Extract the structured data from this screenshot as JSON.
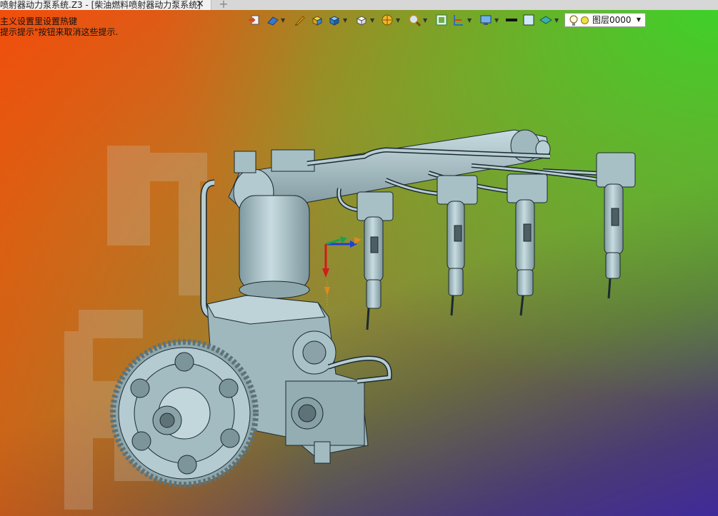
{
  "tab": {
    "title": "喷射器动力泵系统.Z3 - [柴油燃料喷射器动力泵系统]",
    "close_glyph": "✕",
    "new_glyph": "+"
  },
  "viewport": {
    "hint_line1": "主义设置里设置热键",
    "hint_line2": "提示提示\"按钮来取消这些提示."
  },
  "toolbar": {
    "icons": [
      "import-icon",
      "view-dropdown-icon",
      "pencil-icon",
      "cube-yellow-icon",
      "cube-blue-icon",
      "cube-wire-icon",
      "render-mode-icon",
      "zoom-icon",
      "grid-icon",
      "filter-icon",
      "display-icon",
      "line-color-icon",
      "fill-color-icon",
      "layer-shape-icon"
    ],
    "layer": {
      "label": "图层0000"
    }
  },
  "colors": {
    "part": "#a9c3ca",
    "part_dark": "#5d7378",
    "edge": "#1c2a30",
    "axis_x": "#1f3fd6",
    "axis_y": "#19a34a",
    "axis_z": "#d41a1a",
    "handle": "#e08a1a"
  }
}
